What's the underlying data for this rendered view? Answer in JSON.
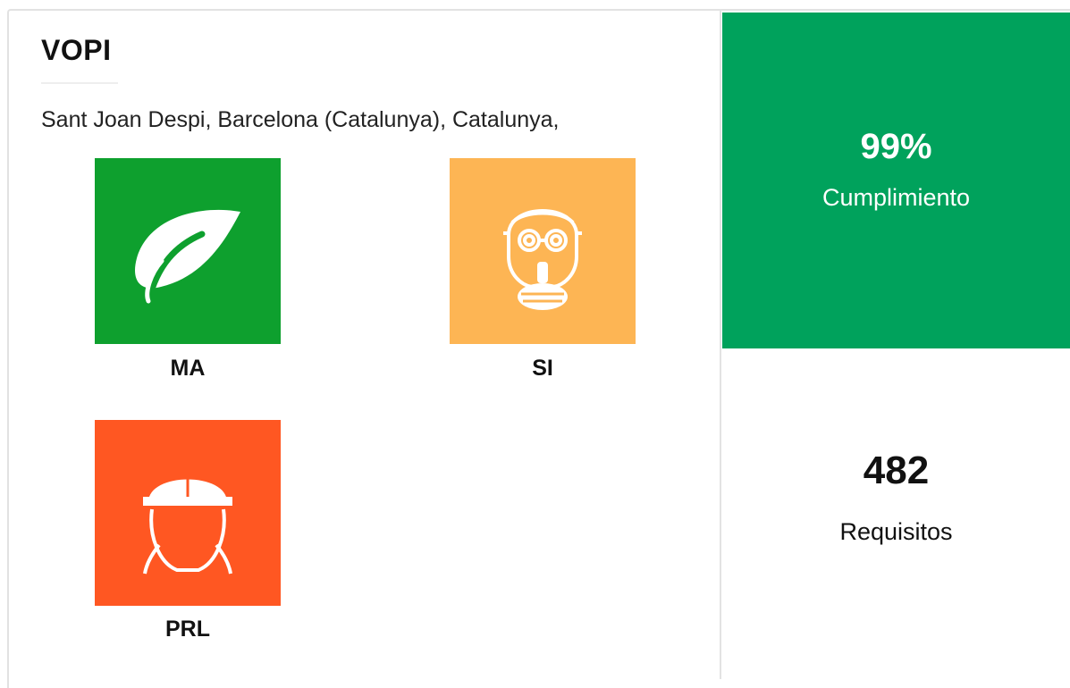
{
  "header": {
    "title": "VOPI",
    "location": "Sant Joan Despi, Barcelona (Catalunya), Catalunya,"
  },
  "categories": [
    {
      "label": "MA",
      "icon": "leaf-icon",
      "color": "#0ea02e"
    },
    {
      "label": "SI",
      "icon": "gas-mask-icon",
      "color": "#fdb554"
    },
    {
      "label": "PRL",
      "icon": "hard-hat-icon",
      "color": "#ff5722"
    }
  ],
  "stats": {
    "compliance": {
      "value": "99%",
      "label": "Cumplimiento",
      "color": "#00a25c"
    },
    "requirements": {
      "value": "482",
      "label": "Requisitos"
    }
  }
}
